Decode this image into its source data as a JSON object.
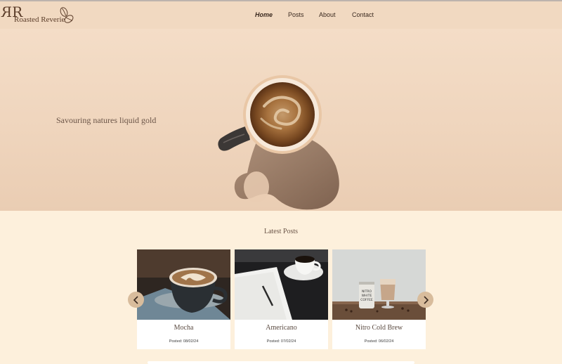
{
  "header": {
    "logo": {
      "monogram": "RR",
      "name": "Roasted Reverie",
      "icon": "coffee-beans-icon"
    },
    "nav": [
      {
        "label": "Home",
        "active": true
      },
      {
        "label": "Posts"
      },
      {
        "label": "About"
      },
      {
        "label": "Contact"
      }
    ]
  },
  "hero": {
    "tagline": "Savouring natures liquid gold",
    "image": "coffee-cup-top-view"
  },
  "latest_posts": {
    "title": "Latest Posts",
    "prev_icon": "chevron-left-icon",
    "next_icon": "chevron-right-icon",
    "posts": [
      {
        "title": "Mocha",
        "date": "Posted: 08/02/24",
        "image": "mocha-cup"
      },
      {
        "title": "Americano",
        "date": "Posted: 07/02/24",
        "image": "americano-cup-notebook"
      },
      {
        "title": "Nitro Cold Brew",
        "date": "Posted: 06/02/24",
        "image": "nitro-can-glass"
      }
    ]
  },
  "colors": {
    "header_bg": "#f1d9c1",
    "page_bg": "#fdf0dc",
    "arrow_bg": "#d8bc9c",
    "brand_text": "#5b3d2a"
  }
}
